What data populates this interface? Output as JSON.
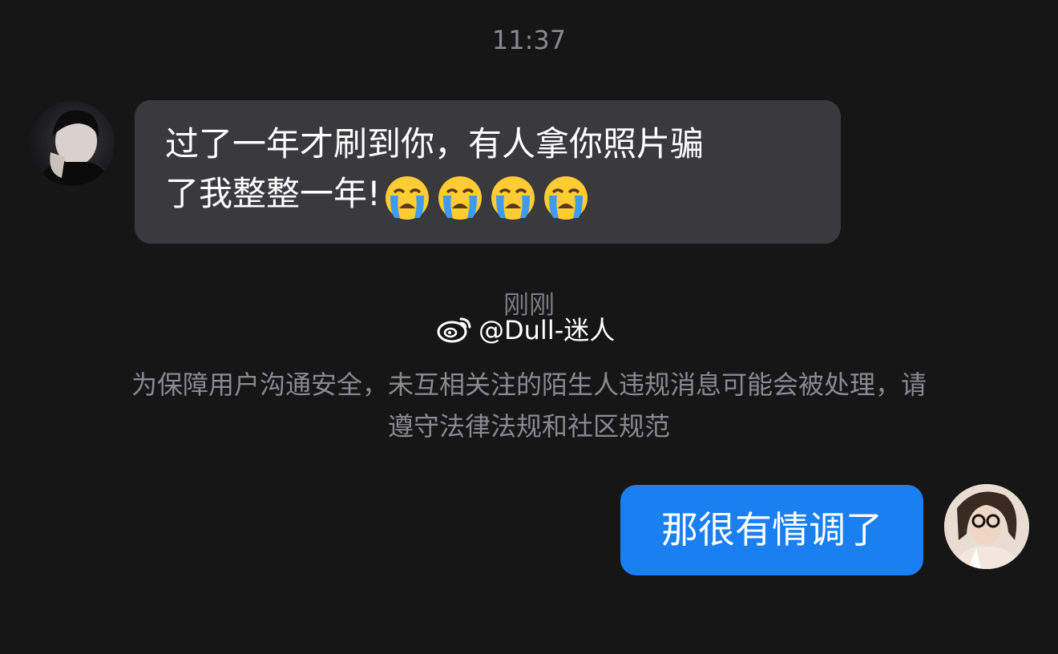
{
  "header": {
    "time": "11:37"
  },
  "conversation": {
    "incoming": {
      "line1": "过了一年才刷到你，有人拿你照片骗",
      "line2": "了我整整一年!",
      "emoji_count": 4,
      "emoji_name": "loudly-crying-face-emoji"
    },
    "system_time": "刚刚",
    "notice": "为保障用户沟通安全，未互相关注的陌生人违规消息可能会被处理，请遵守法律法规和社区规范",
    "outgoing": {
      "text": "那很有情调了"
    }
  },
  "watermark": {
    "text": "@Dull-迷人",
    "icon": "weibo-logo-icon"
  },
  "colors": {
    "background": "#161617",
    "incoming_bubble": "#3a3a3c",
    "outgoing_bubble": "#1a7ff0",
    "muted_text": "#8a8a8e"
  }
}
